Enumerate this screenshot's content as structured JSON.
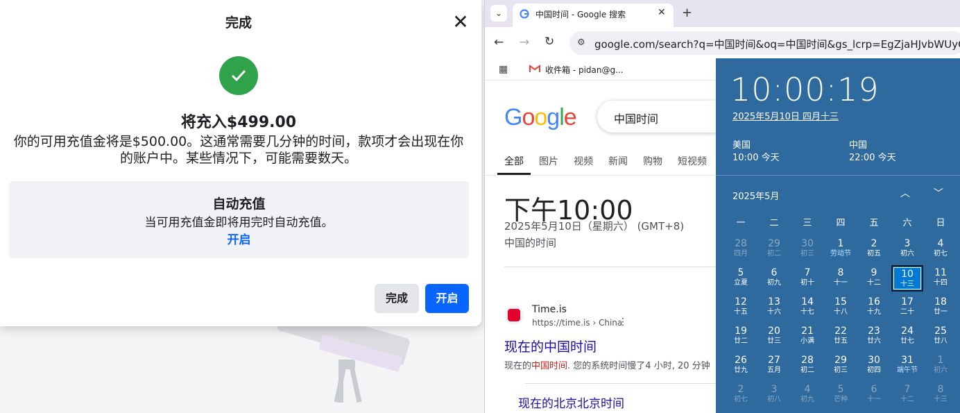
{
  "dialog": {
    "title": "完成",
    "close_label": "✕",
    "amount_title": "将充入$499.00",
    "amount_desc": "你的可用充值金将是$500.00。这通常需要几分钟的时间，款项才会出现在你的账户中。某些情况下，可能需要数天。",
    "auto_recharge": {
      "title": "自动充值",
      "desc": "当可用充值金即将用完时自动充值。",
      "link": "开启"
    },
    "done_button": "完成",
    "enable_button": "开启",
    "success_color": "#31a24c",
    "primary_color": "#0866ff"
  },
  "browser": {
    "tab_title": "中国时间 - Google 搜索",
    "tab_close": "✕",
    "new_tab": "+",
    "url": "google.com/search?q=中国时间&oq=中国时间&gs_lcrp=EgZjaHJvbWUyCQgAEE",
    "bookmark_gmail": "收件箱 - pidan@g...",
    "search_query": "中国时间",
    "tabs": [
      "全部",
      "图片",
      "视频",
      "新闻",
      "购物",
      "短视频"
    ],
    "time_big": "下午10:00",
    "time_date": "2025年5月10日（星期六） (GMT+8)",
    "time_place": "中国的时间",
    "result1": {
      "site": "Time.is",
      "url": "https://time.is › China",
      "title": "现在的中国时间",
      "snippet_pre": "现在的",
      "snippet_hl": "中国时间",
      "snippet_post": ". 您的系统时间慢了4 小时, 20 分钟"
    },
    "result2": {
      "title": "现在的北京北京时间"
    }
  },
  "google_logo": [
    {
      "ch": "G",
      "color": "#4285f4"
    },
    {
      "ch": "o",
      "color": "#ea4335"
    },
    {
      "ch": "o",
      "color": "#fbbc05"
    },
    {
      "ch": "g",
      "color": "#4285f4"
    },
    {
      "ch": "l",
      "color": "#34a853"
    },
    {
      "ch": "e",
      "color": "#ea4335"
    }
  ],
  "clock": {
    "time": "10:00:19",
    "date": "2025年5月10日 四月十三",
    "clocks": [
      {
        "name": "美国",
        "time": "10:00 今天"
      },
      {
        "name": "中国",
        "time": "22:00 今天"
      }
    ],
    "month": "2025年5月",
    "up_icon": "︿",
    "down_icon": "﹀",
    "weekdays": [
      "一",
      "二",
      "三",
      "四",
      "五",
      "六",
      "日"
    ],
    "days": [
      {
        "n": "28",
        "l": "四月",
        "dim": true
      },
      {
        "n": "29",
        "l": "初二",
        "dim": true
      },
      {
        "n": "30",
        "l": "初三",
        "dim": true
      },
      {
        "n": "1",
        "l": "劳动节",
        "festival": true
      },
      {
        "n": "2",
        "l": "初五"
      },
      {
        "n": "3",
        "l": "初六"
      },
      {
        "n": "4",
        "l": "初七"
      },
      {
        "n": "5",
        "l": "立夏"
      },
      {
        "n": "6",
        "l": "初九"
      },
      {
        "n": "7",
        "l": "初十"
      },
      {
        "n": "8",
        "l": "十一"
      },
      {
        "n": "9",
        "l": "十二"
      },
      {
        "n": "10",
        "l": "十三",
        "today": true
      },
      {
        "n": "11",
        "l": "十四"
      },
      {
        "n": "12",
        "l": "十五"
      },
      {
        "n": "13",
        "l": "十六"
      },
      {
        "n": "14",
        "l": "十七"
      },
      {
        "n": "15",
        "l": "十八"
      },
      {
        "n": "16",
        "l": "十九"
      },
      {
        "n": "17",
        "l": "二十"
      },
      {
        "n": "18",
        "l": "廿一"
      },
      {
        "n": "19",
        "l": "廿二"
      },
      {
        "n": "20",
        "l": "廿三"
      },
      {
        "n": "21",
        "l": "小满"
      },
      {
        "n": "22",
        "l": "廿五"
      },
      {
        "n": "23",
        "l": "廿六"
      },
      {
        "n": "24",
        "l": "廿七"
      },
      {
        "n": "25",
        "l": "廿八"
      },
      {
        "n": "26",
        "l": "廿九"
      },
      {
        "n": "27",
        "l": "五月"
      },
      {
        "n": "28",
        "l": "初二"
      },
      {
        "n": "29",
        "l": "初三"
      },
      {
        "n": "30",
        "l": "初四"
      },
      {
        "n": "31",
        "l": "端午节",
        "festival": true
      },
      {
        "n": "1",
        "l": "初六",
        "dim": true
      },
      {
        "n": "2",
        "l": "初七",
        "dim": true
      },
      {
        "n": "3",
        "l": "初八",
        "dim": true
      },
      {
        "n": "4",
        "l": "初九",
        "dim": true
      },
      {
        "n": "5",
        "l": "芒种",
        "dim": true
      },
      {
        "n": "6",
        "l": "十一",
        "dim": true
      },
      {
        "n": "7",
        "l": "十二",
        "dim": true
      },
      {
        "n": "8",
        "l": "十三",
        "dim": true
      }
    ],
    "bg_color": "#2f6a9e",
    "today_color": "#0078d4"
  }
}
